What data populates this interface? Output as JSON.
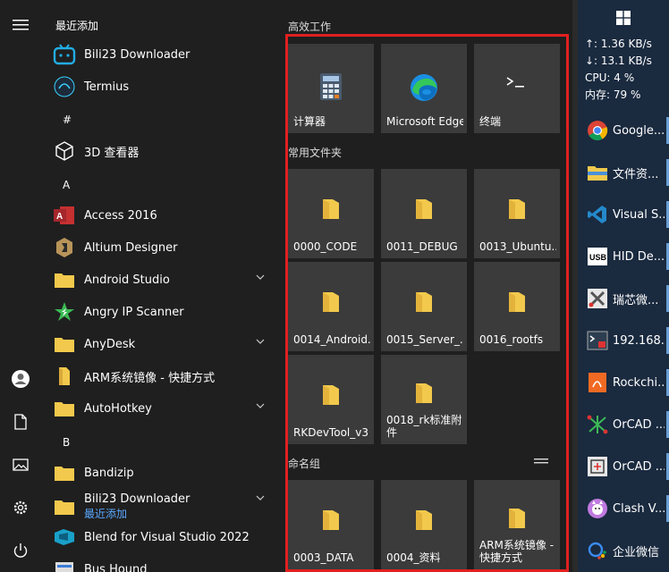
{
  "app_list": {
    "recent_header": "最近添加",
    "items": [
      {
        "label": "Bili23 Downloader"
      },
      {
        "label": "Termius"
      },
      {
        "label": "#"
      },
      {
        "label": "3D 查看器"
      },
      {
        "label": "A"
      },
      {
        "label": "Access 2016"
      },
      {
        "label": "Altium Designer"
      },
      {
        "label": "Android Studio"
      },
      {
        "label": "Angry IP Scanner"
      },
      {
        "label": "AnyDesk"
      },
      {
        "label": "ARM系统镜像 - 快捷方式"
      },
      {
        "label": "AutoHotkey"
      },
      {
        "label": "B"
      },
      {
        "label": "Bandizip"
      },
      {
        "label": "Bili23 Downloader",
        "sub": "最近添加"
      },
      {
        "label": "Blend for Visual Studio 2022"
      },
      {
        "label": "Bus Hound"
      }
    ]
  },
  "tiles": {
    "group1": "高效工作",
    "group1_tiles": [
      "计算器",
      "Microsoft Edge",
      "终端"
    ],
    "group2": "常用文件夹",
    "group2_tiles": [
      "0000_CODE",
      "0011_DEBUG",
      "0013_Ubuntu...",
      "0014_Android...",
      "0015_Server_...",
      "0016_rootfs",
      "RKDevTool_v3",
      "0018_rk标准附件"
    ],
    "group3": "命名组",
    "group3_tiles": [
      "0003_DATA",
      "0004_资料",
      "ARM系统镜像 - 快捷方式"
    ]
  },
  "taskbar": {
    "net_up": "↑: 1.36 KB/s",
    "net_down": "↓: 13.1 KB/s",
    "cpu": "CPU: 4 %",
    "mem": "内存: 79 %",
    "items": [
      "Google...",
      "文件资...",
      "Visual S...",
      "HID De...",
      "瑞芯微...",
      "192.168...",
      "Rockchi...",
      "OrCAD ...",
      "OrCAD ...",
      "Clash V...",
      "企业微信"
    ]
  },
  "colors": {
    "accent": "#e02020",
    "folder": "#f2c94c",
    "link": "#5aa7ff"
  }
}
